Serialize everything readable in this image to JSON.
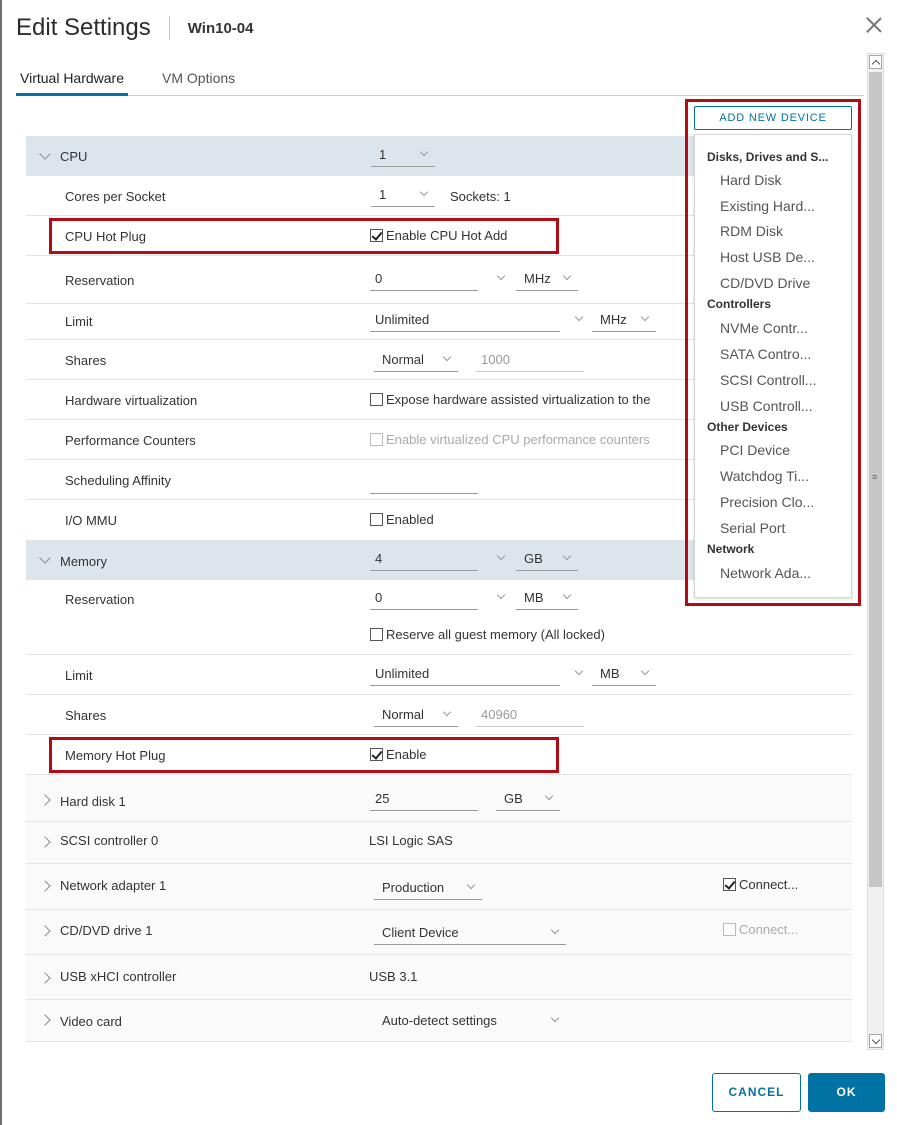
{
  "dialog": {
    "title": "Edit Settings",
    "vm_name": "Win10-04",
    "tabs": [
      {
        "label": "Virtual Hardware",
        "active": true
      },
      {
        "label": "VM Options",
        "active": false
      }
    ]
  },
  "add_device": {
    "button_label": "ADD NEW DEVICE",
    "menu": [
      {
        "group": "Disks, Drives and S...",
        "items": [
          "Hard Disk",
          "Existing Hard...",
          "RDM Disk",
          "Host USB De...",
          "CD/DVD Drive"
        ]
      },
      {
        "group": "Controllers",
        "items": [
          "NVMe Contr...",
          "SATA Contro...",
          "SCSI Controll...",
          "USB Controll..."
        ]
      },
      {
        "group": "Other Devices",
        "items": [
          "PCI Device",
          "Watchdog Ti...",
          "Precision Clo...",
          "Serial Port"
        ]
      },
      {
        "group": "Network",
        "items": [
          "Network Ada..."
        ]
      }
    ]
  },
  "cpu": {
    "label": "CPU",
    "value": "1",
    "cores_per_socket": {
      "label": "Cores per Socket",
      "value": "1",
      "sockets": "Sockets: 1"
    },
    "hot_plug": {
      "label": "CPU Hot Plug",
      "checkbox": "Enable CPU Hot Add",
      "checked": true
    },
    "reservation": {
      "label": "Reservation",
      "value": "0",
      "unit": "MHz"
    },
    "limit": {
      "label": "Limit",
      "value": "Unlimited",
      "unit": "MHz"
    },
    "shares": {
      "label": "Shares",
      "value": "Normal",
      "number": "1000"
    },
    "hw_virt": {
      "label": "Hardware virtualization",
      "checkbox": "Expose hardware assisted virtualization to the",
      "checked": false
    },
    "perf_counters": {
      "label": "Performance Counters",
      "checkbox": "Enable virtualized CPU performance counters",
      "checked": false
    },
    "sched_affinity": {
      "label": "Scheduling Affinity",
      "value": ""
    },
    "iommu": {
      "label": "I/O MMU",
      "checkbox": "Enabled",
      "checked": false
    }
  },
  "memory": {
    "label": "Memory",
    "value": "4",
    "unit": "GB",
    "reservation": {
      "label": "Reservation",
      "value": "0",
      "unit": "MB",
      "reserve_all": "Reserve all guest memory (All locked)"
    },
    "limit": {
      "label": "Limit",
      "value": "Unlimited",
      "unit": "MB"
    },
    "shares": {
      "label": "Shares",
      "value": "Normal",
      "number": "40960"
    },
    "hot_plug": {
      "label": "Memory Hot Plug",
      "checkbox": "Enable",
      "checked": true
    }
  },
  "devices": {
    "hard_disk": {
      "label": "Hard disk 1",
      "value": "25",
      "unit": "GB"
    },
    "scsi": {
      "label": "SCSI controller 0",
      "value": "LSI Logic SAS"
    },
    "network": {
      "label": "Network adapter 1",
      "value": "Production",
      "connect": "Connect..."
    },
    "cddvd": {
      "label": "CD/DVD drive 1",
      "value": "Client Device",
      "connect": "Connect..."
    },
    "usb": {
      "label": "USB xHCI controller",
      "value": "USB 3.1"
    },
    "video": {
      "label": "Video card",
      "value": "Auto-detect settings"
    }
  },
  "footer": {
    "cancel": "CANCEL",
    "ok": "OK"
  },
  "colors": {
    "accent": "#0072a3",
    "highlight": "#b00e14",
    "header_row": "#dde5ec"
  }
}
